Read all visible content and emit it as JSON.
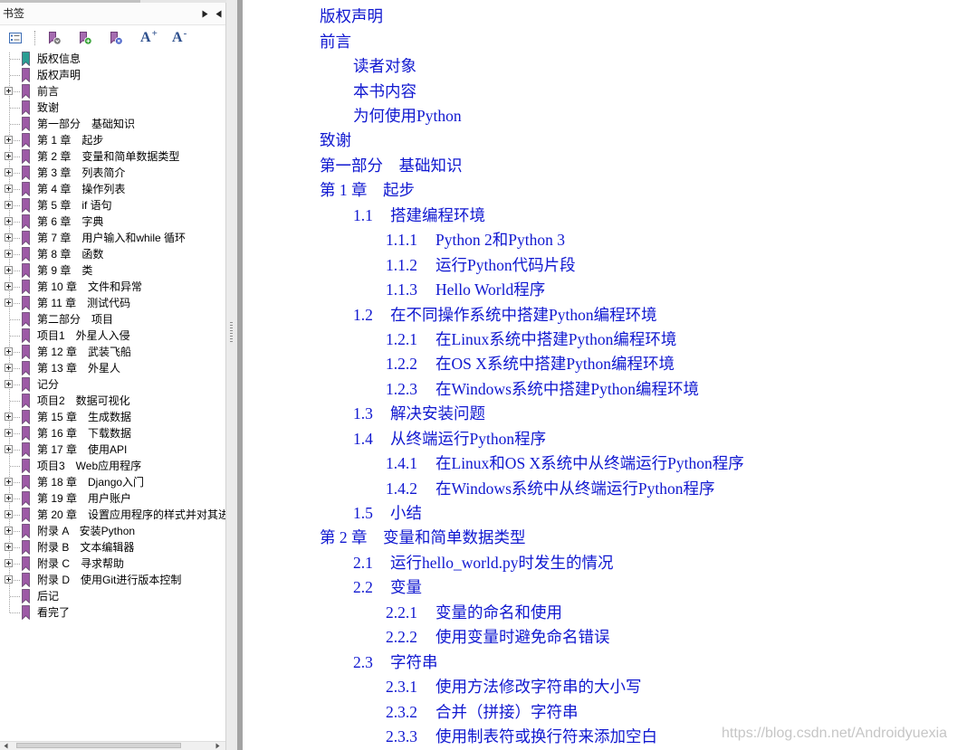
{
  "sidebar": {
    "title": "书签",
    "header_icons": [
      "panel-options-arrow-icon",
      "panel-collapse-arrow-icon"
    ],
    "toolbar": {
      "icons": [
        "bookmark-list-icon",
        "expand-current-bookmark-icon",
        "add-bookmark-icon",
        "delete-bookmark-icon"
      ],
      "font_increase": {
        "letter": "A",
        "sign": "+"
      },
      "font_decrease": {
        "letter": "A",
        "sign": "-"
      }
    },
    "bookmarks": [
      {
        "label": "版权信息",
        "expandable": false,
        "current": true
      },
      {
        "label": "版权声明",
        "expandable": false
      },
      {
        "label": "前言",
        "expandable": true
      },
      {
        "label": "致谢",
        "expandable": false
      },
      {
        "label": "第一部分　基础知识",
        "expandable": false
      },
      {
        "label": "第 1 章　起步",
        "expandable": true
      },
      {
        "label": "第 2 章　变量和简单数据类型",
        "expandable": true
      },
      {
        "label": "第 3 章　列表简介",
        "expandable": true
      },
      {
        "label": "第 4 章　操作列表",
        "expandable": true
      },
      {
        "label": "第 5 章　if 语句",
        "expandable": true
      },
      {
        "label": "第 6 章　字典",
        "expandable": true
      },
      {
        "label": "第 7 章　用户输入和while 循环",
        "expandable": true
      },
      {
        "label": "第 8 章　函数",
        "expandable": true
      },
      {
        "label": "第 9 章　类",
        "expandable": true
      },
      {
        "label": "第 10 章　文件和异常",
        "expandable": true
      },
      {
        "label": "第 11 章　测试代码",
        "expandable": true
      },
      {
        "label": "第二部分　项目",
        "expandable": false
      },
      {
        "label": "项目1　外星人入侵",
        "expandable": false
      },
      {
        "label": "第 12 章　武装飞船",
        "expandable": true
      },
      {
        "label": "第 13 章　外星人",
        "expandable": true
      },
      {
        "label": "记分",
        "expandable": true
      },
      {
        "label": "项目2　数据可视化",
        "expandable": false
      },
      {
        "label": "第 15 章　生成数据",
        "expandable": true
      },
      {
        "label": "第 16 章　下载数据",
        "expandable": true
      },
      {
        "label": "第 17 章　使用API",
        "expandable": true
      },
      {
        "label": "项目3　Web应用程序",
        "expandable": false
      },
      {
        "label": "第 18 章　Django入门",
        "expandable": true
      },
      {
        "label": "第 19 章　用户账户",
        "expandable": true
      },
      {
        "label": "第 20 章　设置应用程序的样式并对其进",
        "expandable": true
      },
      {
        "label": "附录 A　安装Python",
        "expandable": true
      },
      {
        "label": "附录 B　文本编辑器",
        "expandable": true
      },
      {
        "label": "附录 C　寻求帮助",
        "expandable": true
      },
      {
        "label": "附录 D　使用Git进行版本控制",
        "expandable": true
      },
      {
        "label": "后记",
        "expandable": false
      },
      {
        "label": "看完了",
        "expandable": false
      }
    ]
  },
  "document": {
    "toc": [
      {
        "level": 1,
        "text": "版权声明"
      },
      {
        "level": 1,
        "text": "前言"
      },
      {
        "level": 2,
        "text": "读者对象"
      },
      {
        "level": 2,
        "text": "本书内容"
      },
      {
        "level": 2,
        "text": "为何使用Python"
      },
      {
        "level": 1,
        "text": "致谢"
      },
      {
        "level": 1,
        "text": "第一部分　基础知识"
      },
      {
        "level": 1,
        "text": "第 1 章　起步"
      },
      {
        "level": 2,
        "num": "1.1",
        "text": "搭建编程环境"
      },
      {
        "level": 3,
        "num": "1.1.1",
        "text": "Python 2和Python 3"
      },
      {
        "level": 3,
        "num": "1.1.2",
        "text": "运行Python代码片段"
      },
      {
        "level": 3,
        "num": "1.1.3",
        "text": "Hello World程序"
      },
      {
        "level": 2,
        "num": "1.2",
        "text": "在不同操作系统中搭建Python编程环境"
      },
      {
        "level": 3,
        "num": "1.2.1",
        "text": "在Linux系统中搭建Python编程环境"
      },
      {
        "level": 3,
        "num": "1.2.2",
        "text": "在OS X系统中搭建Python编程环境"
      },
      {
        "level": 3,
        "num": "1.2.3",
        "text": "在Windows系统中搭建Python编程环境"
      },
      {
        "level": 2,
        "num": "1.3",
        "text": "解决安装问题"
      },
      {
        "level": 2,
        "num": "1.4",
        "text": "从终端运行Python程序"
      },
      {
        "level": 3,
        "num": "1.4.1",
        "text": "在Linux和OS X系统中从终端运行Python程序"
      },
      {
        "level": 3,
        "num": "1.4.2",
        "text": "在Windows系统中从终端运行Python程序"
      },
      {
        "level": 2,
        "num": "1.5",
        "text": "小结"
      },
      {
        "level": 1,
        "text": "第 2 章　变量和简单数据类型"
      },
      {
        "level": 2,
        "num": "2.1",
        "text": "运行hello_world.py时发生的情况"
      },
      {
        "level": 2,
        "num": "2.2",
        "text": "变量"
      },
      {
        "level": 3,
        "num": "2.2.1",
        "text": "变量的命名和使用"
      },
      {
        "level": 3,
        "num": "2.2.2",
        "text": "使用变量时避免命名错误"
      },
      {
        "level": 2,
        "num": "2.3",
        "text": "字符串"
      },
      {
        "level": 3,
        "num": "2.3.1",
        "text": "使用方法修改字符串的大小写"
      },
      {
        "level": 3,
        "num": "2.3.2",
        "text": "合并（拼接）字符串"
      },
      {
        "level": 3,
        "num": "2.3.3",
        "text": "使用制表符或换行符来添加空白"
      }
    ],
    "watermark": "https://blog.csdn.net/Androidyuexia"
  },
  "colors": {
    "toc_link": "#1018d0",
    "bookmark": "#9d5aa6",
    "bookmark_current": "#2b9e93",
    "watermark": "#c6c6c6"
  }
}
